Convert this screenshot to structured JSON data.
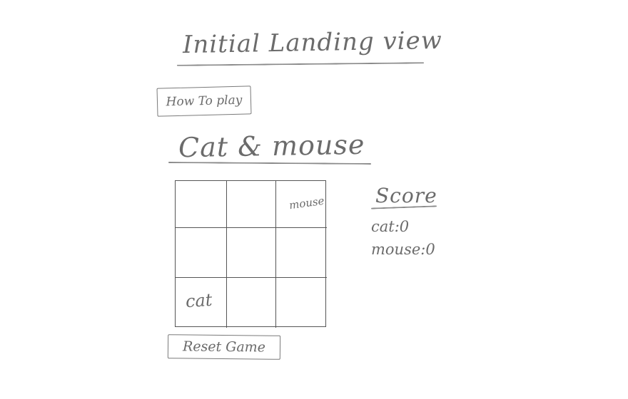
{
  "header": {
    "title": "Initial Landing view"
  },
  "how_to_play": {
    "label": "How To play"
  },
  "game": {
    "title": "Cat & mouse",
    "board": {
      "rows": 3,
      "cols": 3,
      "pieces": {
        "mouse": {
          "row": 0,
          "col": 2,
          "label": "mouse"
        },
        "cat": {
          "row": 2,
          "col": 0,
          "label": "cat"
        }
      }
    },
    "reset_label": "Reset Game"
  },
  "score": {
    "title": "Score",
    "cat_label": "cat:",
    "cat_value": "0",
    "mouse_label": "mouse:",
    "mouse_value": "0"
  }
}
